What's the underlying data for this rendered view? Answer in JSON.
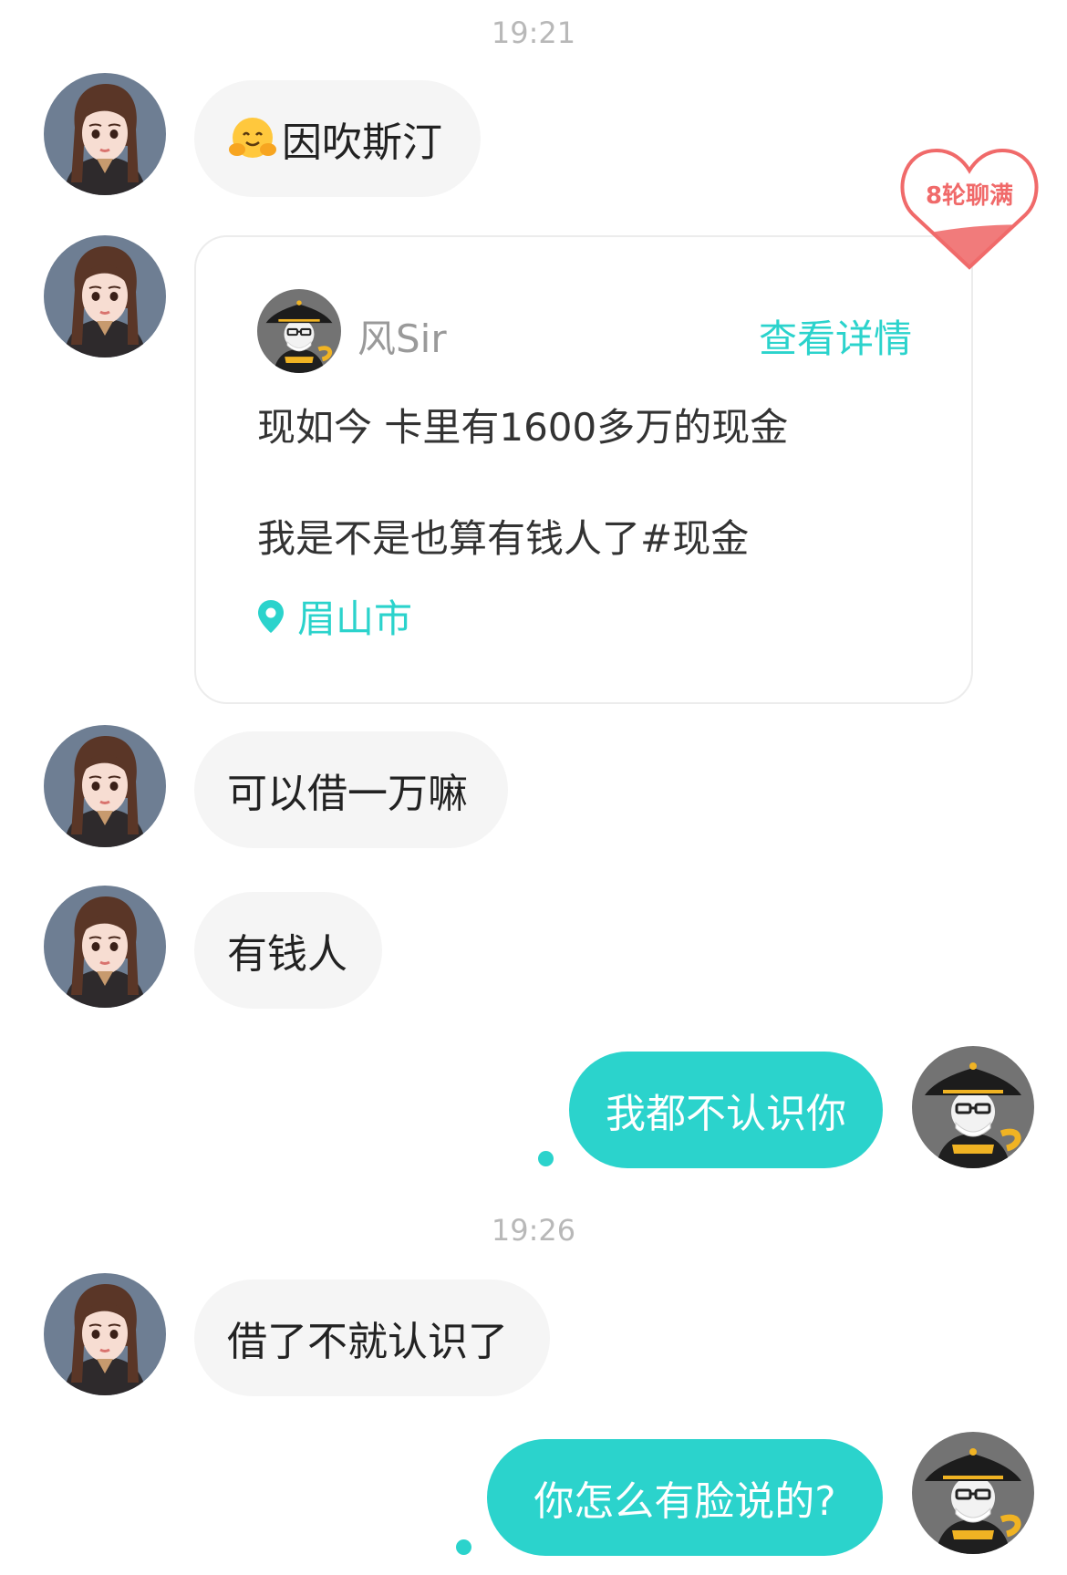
{
  "timestamps": [
    "19:21",
    "19:26"
  ],
  "messages": {
    "m1": "因吹斯汀",
    "m3": "可以借一万嘛",
    "m4": "有钱人",
    "m5": "我都不认识你",
    "m6": "借了不就认识了",
    "m7": "你怎么有脸说的?"
  },
  "card": {
    "author": "风Sir",
    "link": "查看详情",
    "line1": "现如今 卡里有1600多万的现金",
    "line2": "我是不是也算有钱人了#现金",
    "location": "眉山市"
  },
  "badge": {
    "text": "8轮聊满"
  },
  "colors": {
    "accent": "#2bd3cc",
    "bubble_in": "#f5f5f5",
    "badge": "#f06a6a"
  },
  "icons": {
    "location": "location-pin-icon",
    "emoji": "hugging-face-emoji"
  }
}
